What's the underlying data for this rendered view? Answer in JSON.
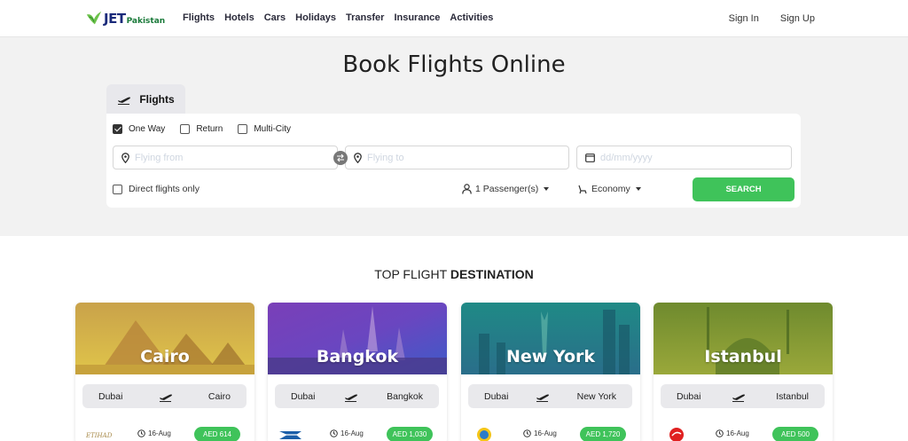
{
  "brand": {
    "name": "JET",
    "suffix": "Pakistan"
  },
  "nav": [
    "Flights",
    "Hotels",
    "Cars",
    "Holidays",
    "Transfer",
    "Insurance",
    "Activities"
  ],
  "auth": {
    "sign_in": "Sign In",
    "sign_up": "Sign Up"
  },
  "hero": {
    "title": "Book Flights Online"
  },
  "search": {
    "tab_label": "Flights",
    "trip_types": [
      {
        "label": "One Way",
        "checked": true
      },
      {
        "label": "Return",
        "checked": false
      },
      {
        "label": "Multi-City",
        "checked": false
      }
    ],
    "from_placeholder": "Flying from",
    "to_placeholder": "Flying to",
    "date_placeholder": "dd/mm/yyyy",
    "direct_label": "Direct flights only",
    "passengers": "1 Passenger(s)",
    "cabin": "Economy",
    "button": "SEARCH"
  },
  "destinations": {
    "title_prefix": "TOP FLIGHT",
    "title_bold": "DESTINATION",
    "cards": [
      {
        "city": "Cairo",
        "from": "Dubai",
        "to": "Cairo",
        "date": "16-Aug",
        "price": "AED 614",
        "airline": "etihad"
      },
      {
        "city": "Bangkok",
        "from": "Dubai",
        "to": "Bangkok",
        "date": "16-Aug",
        "price": "AED 1,030",
        "airline": "kuwait"
      },
      {
        "city": "New York",
        "from": "Dubai",
        "to": "New York",
        "date": "16-Aug",
        "price": "AED 1,720",
        "airline": "ukraine"
      },
      {
        "city": "Istanbul",
        "from": "Dubai",
        "to": "Istanbul",
        "date": "16-Aug",
        "price": "AED 500",
        "airline": "turkish"
      }
    ]
  },
  "colors": {
    "accent_green": "#3fc35a",
    "brand_blue": "#1a2a7a"
  }
}
